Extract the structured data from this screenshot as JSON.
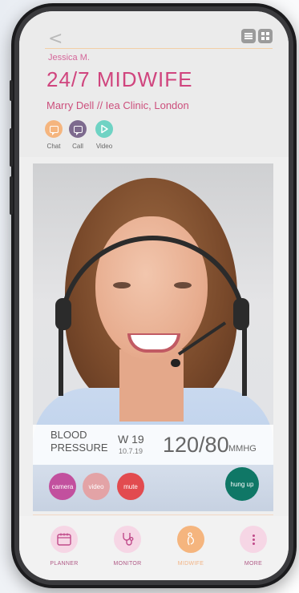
{
  "header": {
    "user_name": "Jessica M.",
    "title": "24/7 MIDWIFE",
    "subtitle": "Marry Dell // Iea Clinic, London",
    "contact": [
      {
        "label": "Chat",
        "color": "#f5b57e"
      },
      {
        "label": "Call",
        "color": "#7d6a8e"
      },
      {
        "label": "Video",
        "color": "#6fd3c4"
      }
    ]
  },
  "vitals": {
    "label": "BLOOD PRESSURE",
    "week": "W 19",
    "date": "10.7.19",
    "value": "120/80",
    "unit": "MMHG"
  },
  "controls": {
    "camera": "camera",
    "video": "video",
    "mute": "mute",
    "hangup": "hung up"
  },
  "nav": [
    {
      "label": "PLANNER",
      "icon": "calendar-icon"
    },
    {
      "label": "MONITOR",
      "icon": "stethoscope-icon"
    },
    {
      "label": "MIDWIFE",
      "icon": "pregnancy-icon"
    },
    {
      "label": "MORE",
      "icon": "more-dots-icon"
    }
  ],
  "colors": {
    "accent": "#d0457e",
    "camera_btn": "#c2509e",
    "video_btn": "#e3a3a6",
    "mute_btn": "#e24b4f",
    "hangup_btn": "#0f7766"
  }
}
